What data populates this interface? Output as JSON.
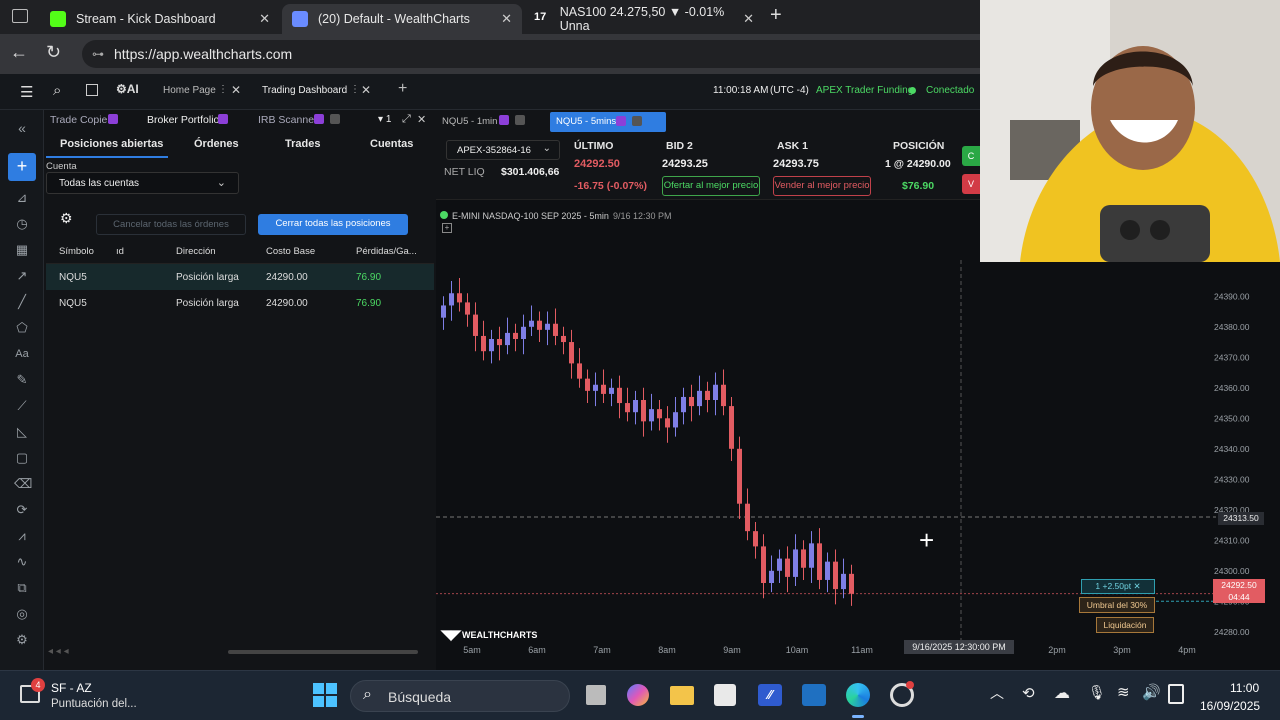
{
  "browser": {
    "tabs": [
      {
        "title": "Stream - Kick Dashboard",
        "fav_color": "#53fc18"
      },
      {
        "title": "(20) Default - WealthCharts",
        "fav_color": "#6a8cff"
      },
      {
        "title": "NAS100 24.275,50 ▼ -0.01% Unna",
        "fav_color": "#ffffff"
      }
    ],
    "new_tab": "+",
    "url": "https://app.wealthcharts.com"
  },
  "header": {
    "home_label": "Home Page",
    "dash_label": "Trading Dashboard",
    "add": "+",
    "time": "11:00:18 AM",
    "tz": "(UTC -4)",
    "account": "APEX Trader Funding",
    "status": "Conectado"
  },
  "panel": {
    "tabs": [
      "Trade Copier",
      "Broker Portfolio",
      "IRB Scanner"
    ],
    "tab_count": "1",
    "subtabs": [
      "Posiciones abiertas",
      "Órdenes",
      "Trades",
      "Cuentas"
    ],
    "account_label": "Cuenta",
    "account_value": "Todas las cuentas",
    "cancel_all": "Cancelar todas las órdenes",
    "close_all": "Cerrar todas las posiciones",
    "columns": [
      "Símbolo",
      "ıd",
      "Dirección",
      "Costo Base",
      "Pérdidas/Ga..."
    ],
    "rows": [
      {
        "symbol": "NQU5",
        "direction": "Posición larga",
        "cost": "24290.00",
        "pl": "76.90"
      },
      {
        "symbol": "NQU5",
        "direction": "Posición larga",
        "cost": "24290.00",
        "pl": "76.90"
      }
    ]
  },
  "chart_tabs": [
    "NQU5 - 1min",
    "NQU5 - 5mins"
  ],
  "quote": {
    "account_select": "APEX-352864-16",
    "netliq_label": "NET LIQ",
    "netliq": "$301.406,66",
    "last_label": "ÚLTIMO",
    "last": "24292.50",
    "change": "-16.75 (-0.07%)",
    "bid_label": "BID 2",
    "bid": "24293.25",
    "bid_btn": "Ofertar al mejor precio",
    "ask_label": "ASK 1",
    "ask": "24293.75",
    "ask_btn": "Vender al mejor precio",
    "pos_label": "POSICIÓN",
    "pos": "1 @ 24290.00",
    "pos_pl": "$76.90",
    "buy_stub": "C",
    "sell_stub": "V"
  },
  "chart": {
    "title": "E-MINI NASDAQ-100 SEP 2025 - 5min",
    "title_date": "9/16 12:30 PM",
    "brand": "WEALTHCHARTS",
    "crosshair_price": "24313.50",
    "crosshair_time": "9/16/2025 12:30:00 PM",
    "last_tag": "24292.50",
    "last_tag_time": "04:44",
    "pos_tag": "1  +2.50pt",
    "threshold_tag": "Umbral del 30%",
    "liq_tag": "Liquidación",
    "up_color": "#7f7fe6",
    "down_color": "#e25c62"
  },
  "chart_data": {
    "type": "candlestick",
    "title": "E-MINI NASDAQ-100 SEP 2025 - 5min",
    "x_ticks": [
      "5am",
      "6am",
      "7am",
      "8am",
      "9am",
      "10am",
      "11am",
      "2pm",
      "3pm",
      "4pm"
    ],
    "y_ticks": [
      24280,
      24290,
      24300,
      24310,
      24320,
      24330,
      24340,
      24350,
      24360,
      24370,
      24380,
      24390
    ],
    "ylim": [
      24276,
      24396
    ],
    "closes": [
      24387,
      24391,
      24388,
      24384,
      24377,
      24372,
      24376,
      24374,
      24378,
      24376,
      24380,
      24382,
      24379,
      24381,
      24377,
      24375,
      24368,
      24363,
      24359,
      24361,
      24358,
      24360,
      24355,
      24352,
      24356,
      24349,
      24353,
      24350,
      24347,
      24352,
      24357,
      24354,
      24359,
      24356,
      24361,
      24354,
      24340,
      24322,
      24313,
      24308,
      24296,
      24300,
      24304,
      24298,
      24307,
      24301,
      24309,
      24297,
      24303,
      24294,
      24299,
      24292.5
    ]
  },
  "taskbar": {
    "weather_badge": "4",
    "weather_title": "SF - AZ",
    "weather_sub": "Puntuación del...",
    "search": "Búsqueda",
    "time": "11:00",
    "date": "16/09/2025"
  }
}
